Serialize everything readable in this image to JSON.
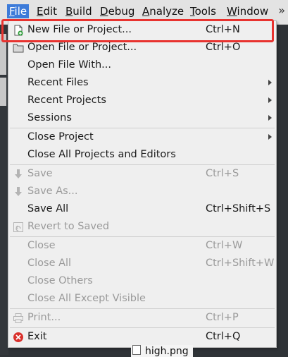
{
  "menubar": {
    "items": [
      {
        "label": "File",
        "mn": "F"
      },
      {
        "label": "Edit",
        "mn": "E"
      },
      {
        "label": "Build",
        "mn": "B"
      },
      {
        "label": "Debug",
        "mn": "D"
      },
      {
        "label": "Analyze",
        "mn": "A"
      },
      {
        "label": "Tools",
        "mn": "T"
      },
      {
        "label": "Window",
        "mn": "W"
      }
    ]
  },
  "file_menu": {
    "new_file": {
      "label": "New File or Project...",
      "shortcut": "Ctrl+N",
      "icon": "new-file-icon"
    },
    "open_file": {
      "label": "Open File or Project...",
      "shortcut": "Ctrl+O",
      "icon": "open-folder-icon"
    },
    "open_with": {
      "label": "Open File With..."
    },
    "recent_files": {
      "label": "Recent Files"
    },
    "recent_projects": {
      "label": "Recent Projects"
    },
    "sessions": {
      "label": "Sessions"
    },
    "close_project": {
      "label": "Close Project"
    },
    "close_all_projects": {
      "label": "Close All Projects and Editors"
    },
    "save": {
      "label": "Save",
      "shortcut": "Ctrl+S",
      "icon": "save-icon"
    },
    "save_as": {
      "label": "Save As...",
      "icon": "save-as-icon"
    },
    "save_all": {
      "label": "Save All",
      "shortcut": "Ctrl+Shift+S"
    },
    "revert": {
      "label": "Revert to Saved",
      "icon": "revert-icon"
    },
    "close": {
      "label": "Close",
      "shortcut": "Ctrl+W"
    },
    "close_all": {
      "label": "Close All",
      "shortcut": "Ctrl+Shift+W"
    },
    "close_others": {
      "label": "Close Others"
    },
    "close_all_except": {
      "label": "Close All Except Visible"
    },
    "print": {
      "label": "Print...",
      "shortcut": "Ctrl+P",
      "icon": "print-icon"
    },
    "exit": {
      "label": "Exit",
      "shortcut": "Ctrl+Q",
      "icon": "exit-icon"
    }
  },
  "background": {
    "file_name": "high.png"
  },
  "colors": {
    "accent": "#3d7bd9",
    "highlight_box": "#e8332f",
    "exit_icon": "#d9302b"
  }
}
